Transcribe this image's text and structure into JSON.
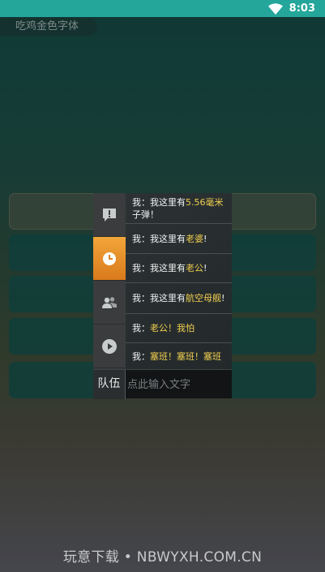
{
  "status_bar": {
    "time": "8:03",
    "bg_color": "#24a69a"
  },
  "app": {
    "title": "吃鸡金色字体"
  },
  "tabs": [
    {
      "icon": "alert-icon",
      "active": false
    },
    {
      "icon": "clock-icon",
      "active": true
    },
    {
      "icon": "team-icon",
      "active": false
    },
    {
      "icon": "play-icon",
      "active": false
    }
  ],
  "messages": [
    {
      "prefix": "我：我这里有",
      "highlight": "5.56毫米",
      "suffix": "子弹！"
    },
    {
      "prefix": "我：我这里有",
      "highlight": "老婆",
      "suffix": "!"
    },
    {
      "prefix": "我：我这里有",
      "highlight": "老公",
      "suffix": "!"
    },
    {
      "prefix": "我：我这里有",
      "highlight": "航空母舰",
      "suffix": "!"
    },
    {
      "prefix": "我：",
      "highlight": "老公！我怕",
      "suffix": ""
    },
    {
      "prefix": "我：",
      "highlight": "塞班！塞班！塞班",
      "suffix": ""
    }
  ],
  "input": {
    "team_label": "队伍",
    "placeholder": "点此输入文字"
  },
  "colors": {
    "highlight": "#f2d04f",
    "active_tab": "#e88f2a"
  },
  "watermark": "玩意下载 • NBWYXH.COM.CN"
}
